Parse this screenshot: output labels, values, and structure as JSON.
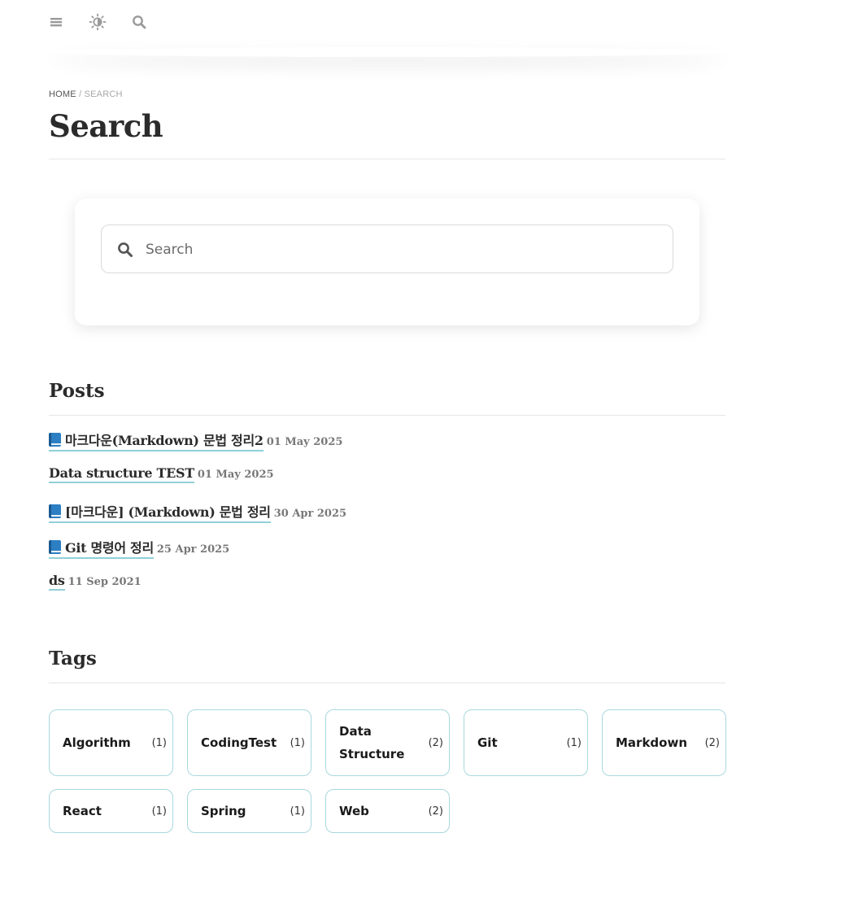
{
  "nav": {
    "icons": [
      "menu-icon",
      "theme-toggle-icon",
      "search-icon"
    ]
  },
  "breadcrumb": {
    "home": "HOME",
    "separator": "/",
    "current": "SEARCH"
  },
  "page": {
    "title": "Search"
  },
  "search": {
    "placeholder": "Search",
    "value": ""
  },
  "posts": {
    "heading": "Posts",
    "items": [
      {
        "title": "마크다운(Markdown) 문법 정리2",
        "date": "01 May 2025",
        "icon": "book-icon"
      },
      {
        "title": "Data structure TEST",
        "date": "01 May 2025",
        "icon": ""
      },
      {
        "title": "[마크다운] (Markdown) 문법 정리",
        "date": "30 Apr 2025",
        "icon": "book-icon"
      },
      {
        "title": "Git 명령어 정리",
        "date": "25 Apr 2025",
        "icon": "book-icon"
      },
      {
        "title": "ds",
        "date": "11 Sep 2021",
        "icon": ""
      }
    ]
  },
  "tags": {
    "heading": "Tags",
    "items": [
      {
        "name": "Algorithm",
        "count": "(1)"
      },
      {
        "name": "CodingTest",
        "count": "(1)"
      },
      {
        "name": "Data Structure",
        "count": "(2)"
      },
      {
        "name": "Git",
        "count": "(1)"
      },
      {
        "name": "Markdown",
        "count": "(2)"
      },
      {
        "name": "React",
        "count": "(1)"
      },
      {
        "name": "Spring",
        "count": "(1)"
      },
      {
        "name": "Web",
        "count": "(2)"
      }
    ]
  },
  "colors": {
    "link_underline": "#8fd0d6",
    "tag_border": "#a9d8dd",
    "text": "#2b2b2b",
    "muted": "#777777"
  }
}
